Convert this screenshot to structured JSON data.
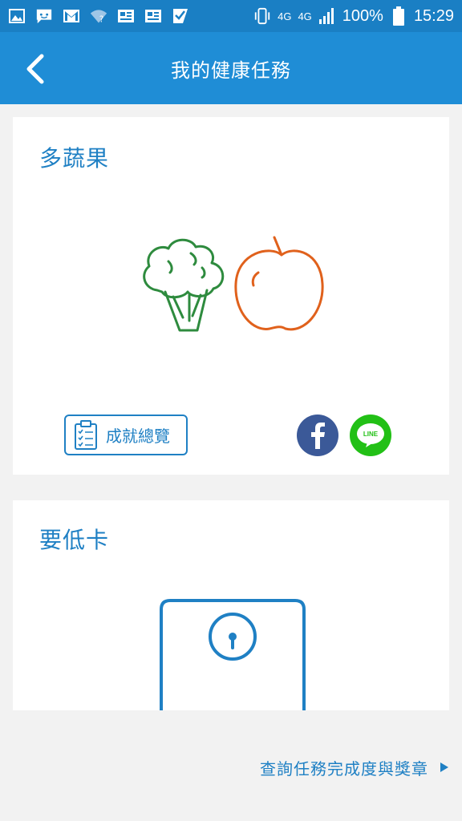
{
  "status_bar": {
    "network": "4G",
    "network2": "4G",
    "battery": "100%",
    "time": "15:29",
    "icons": [
      "gallery-icon",
      "chat-icon",
      "gmail-icon",
      "wifi-unknown-icon",
      "news-icon",
      "news-icon",
      "check-app-icon",
      "vibrate-icon",
      "signal-icon",
      "battery-icon"
    ]
  },
  "app_bar": {
    "title": "我的健康任務",
    "back_icon": "chevron-left-icon"
  },
  "cards": [
    {
      "title": "多蔬果",
      "illustration": "broccoli-apple-icon",
      "achievement_button": "成就總覽",
      "share": [
        "facebook-icon",
        "line-icon"
      ],
      "line_text": "LINE"
    },
    {
      "title": "要低卡",
      "illustration": "scale-icon"
    }
  ],
  "footer": {
    "link": "查詢任務完成度與獎章",
    "arrow_icon": "play-arrow-icon"
  },
  "colors": {
    "primary": "#1f8dd6",
    "status_bar": "#1a7fc4",
    "accent_text": "#1f80c4",
    "broccoli": "#2e8b3e",
    "apple": "#e0611c",
    "facebook": "#3b5998",
    "line": "#22c016"
  }
}
